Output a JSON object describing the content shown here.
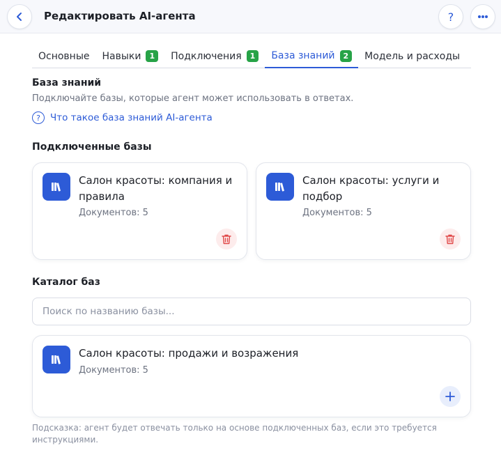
{
  "header": {
    "title": "Редактировать AI-агента",
    "help_label": "?"
  },
  "tabs": [
    {
      "label": "Основные",
      "badge": null,
      "active": false
    },
    {
      "label": "Навыки",
      "badge": "1",
      "active": false
    },
    {
      "label": "Подключения",
      "badge": "1",
      "active": false
    },
    {
      "label": "База знаний",
      "badge": "2",
      "active": true
    },
    {
      "label": "Модель и расходы",
      "badge": null,
      "active": false
    }
  ],
  "knowledge": {
    "title": "База знаний",
    "description": "Подключайте базы, которые агент может использовать в ответах.",
    "help_link": "Что такое база знаний AI-агента"
  },
  "connected": {
    "title": "Подключенные базы",
    "items": [
      {
        "title": "Салон красоты: компания и правила",
        "meta": "Документов: 5"
      },
      {
        "title": "Салон красоты: услуги и подбор",
        "meta": "Документов: 5"
      }
    ]
  },
  "catalog": {
    "title": "Каталог баз",
    "search_placeholder": "Поиск по названию базы...",
    "items": [
      {
        "title": "Салон красоты: продажи и возражения",
        "meta": "Документов: 5"
      }
    ]
  },
  "hint": "Подсказка: агент будет отвечать только на основе подключенных баз, если это требуется инструкциями.",
  "colors": {
    "accent": "#2d5bd7",
    "badge": "#27a347",
    "danger": "#e04848"
  }
}
